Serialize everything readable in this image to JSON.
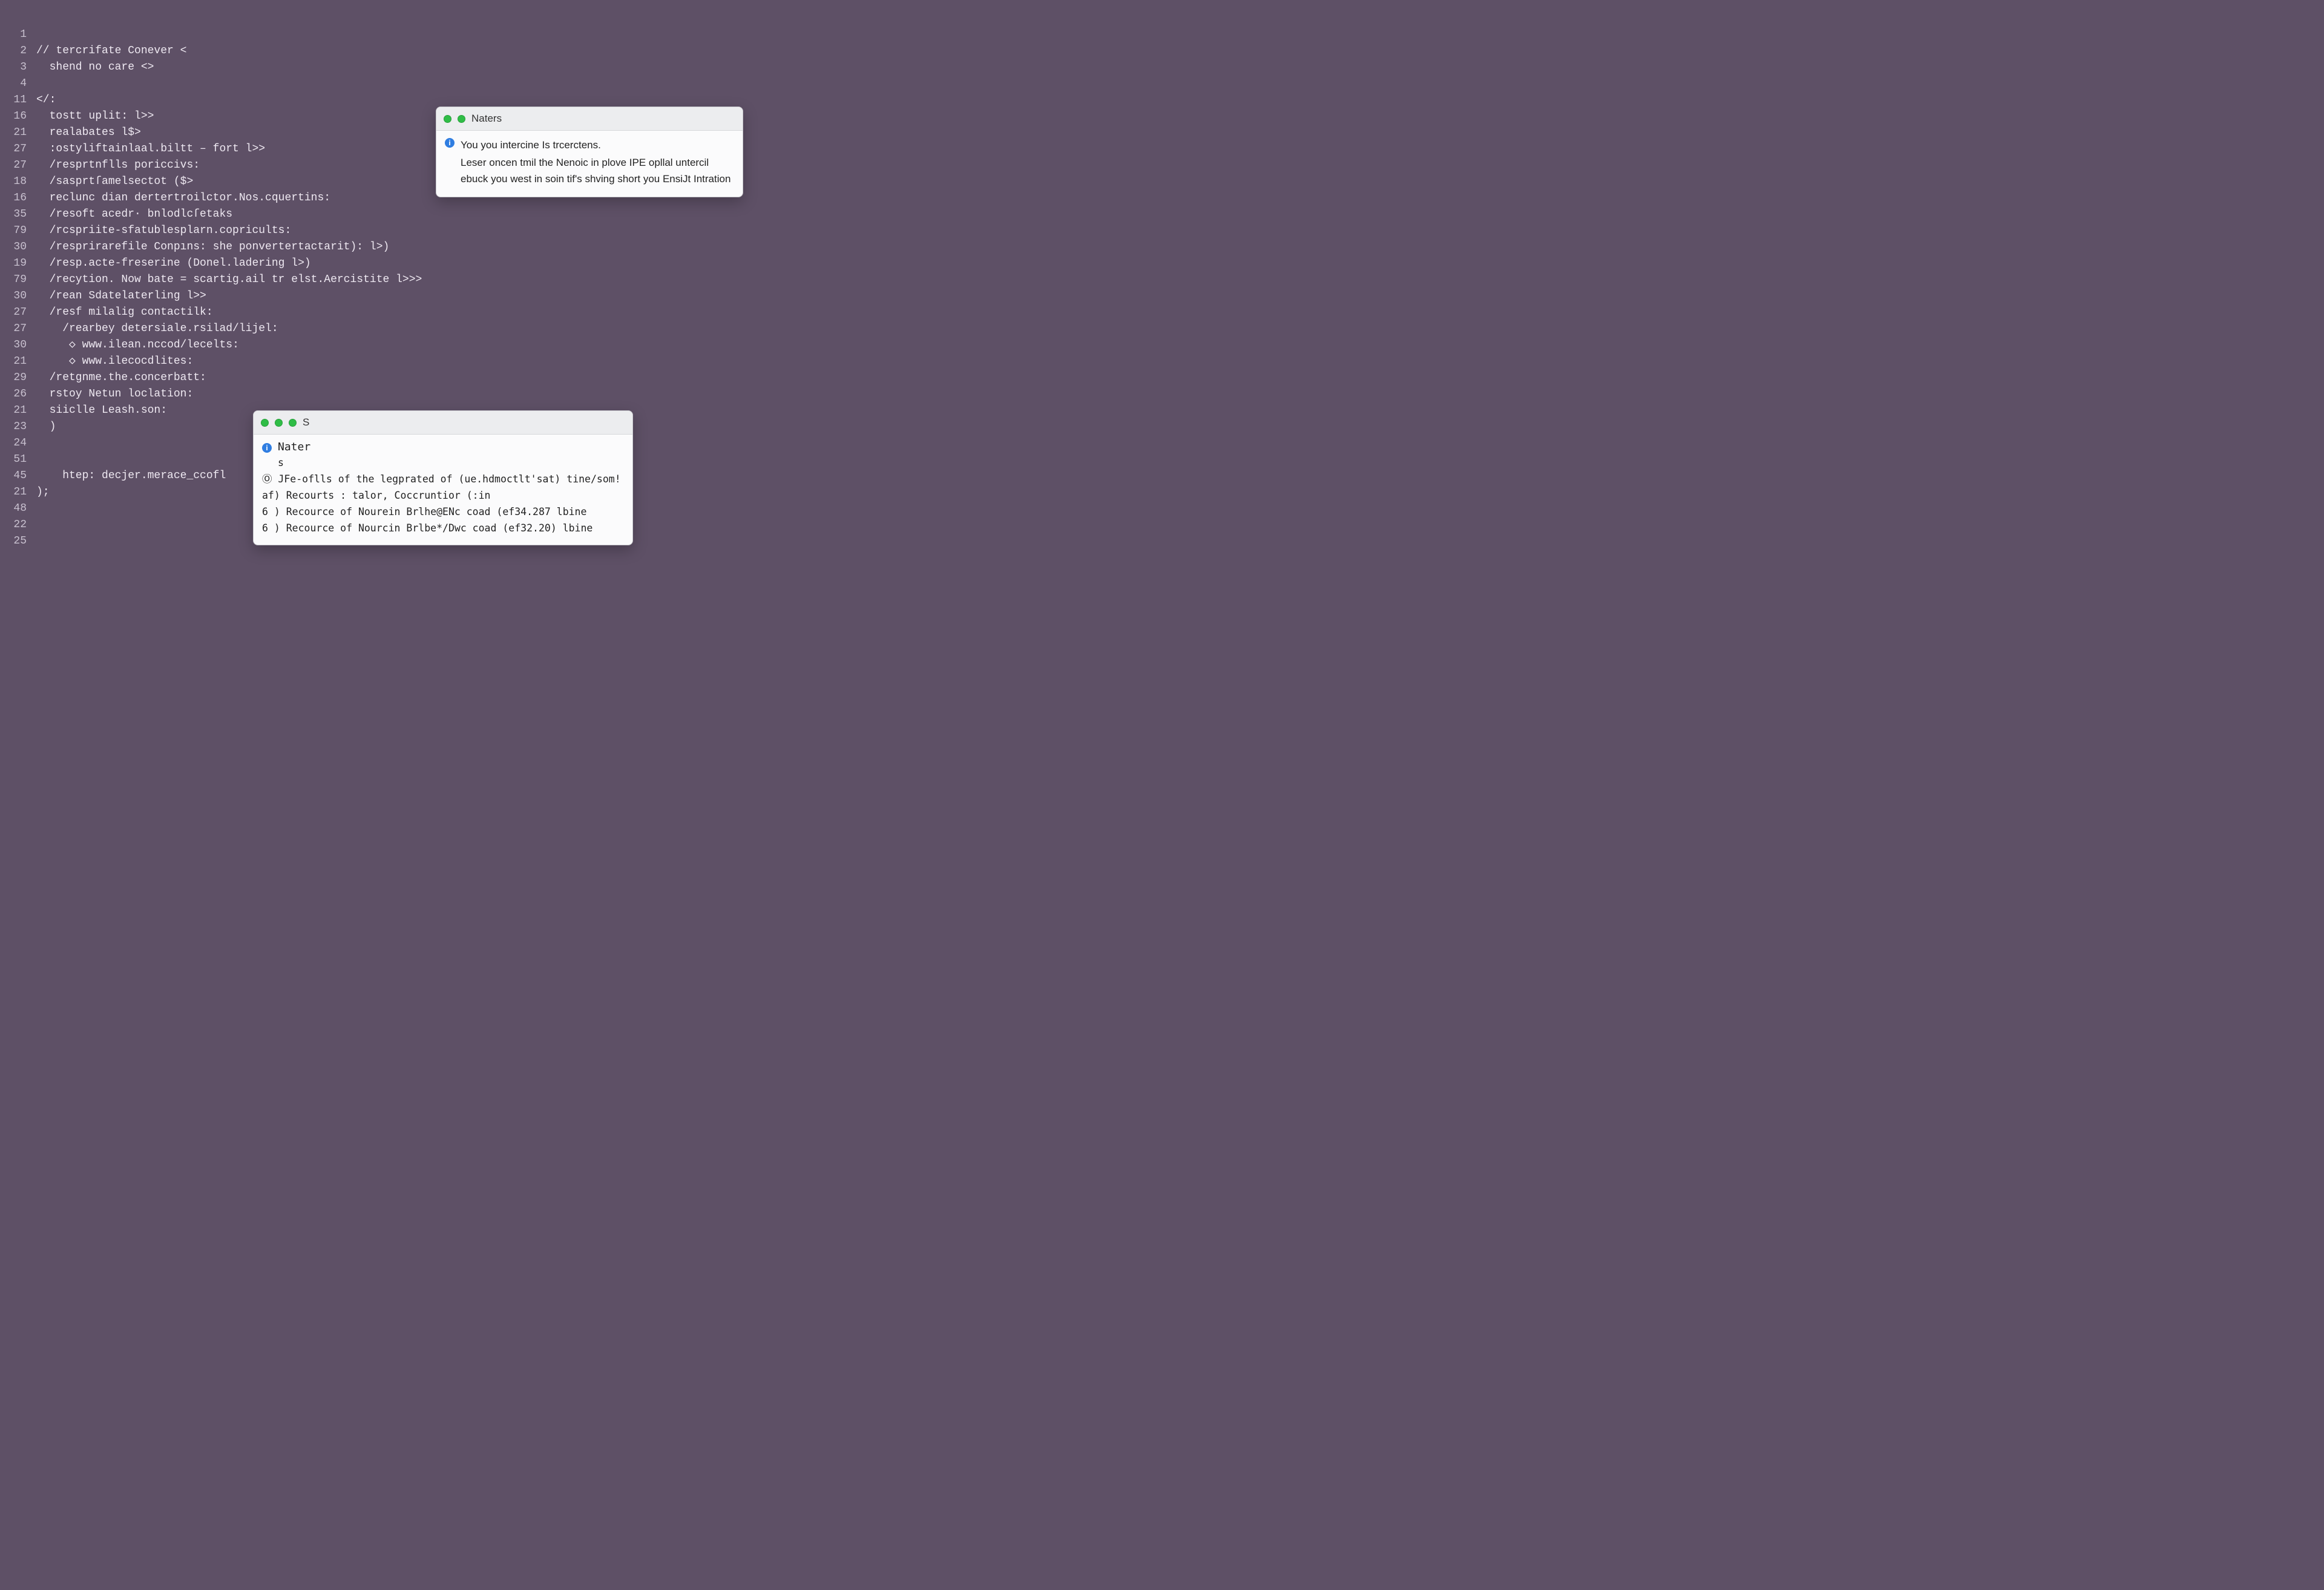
{
  "editor": {
    "lines": [
      {
        "n": "1",
        "t": ""
      },
      {
        "n": "2",
        "t": "// tercrifate Conever <"
      },
      {
        "n": "3",
        "t": "  shend no care <>"
      },
      {
        "n": "4",
        "t": ""
      },
      {
        "n": "11",
        "t": "</:"
      },
      {
        "n": "16",
        "t": "  tostt uplit: l>>"
      },
      {
        "n": "21",
        "t": "  realabates l$>"
      },
      {
        "n": "27",
        "t": "  :ostyliftainlaal.biltt – fort l>>"
      },
      {
        "n": "27",
        "t": "  /resprtnflls poriccivs:"
      },
      {
        "n": "18",
        "t": "  /sasprtſamelsectot ($>"
      },
      {
        "n": "16",
        "t": "  reclunc dian dertertroilctor.Nos.cquertins:"
      },
      {
        "n": "35",
        "t": "  /resoft acedr· bnlodlcſetaks"
      },
      {
        "n": "79",
        "t": "  /rcspriite-sfatublesplarn.copricults:"
      },
      {
        "n": "30",
        "t": "  /resprirarefile Conpıns: she ponvertertactarit): l>)"
      },
      {
        "n": "19",
        "t": "  /resp.acte-freserine (Donel.ladering l>)"
      },
      {
        "n": "79",
        "t": "  /recytion. Now bate = scartig.ail tr elst.Aercistite l>>>"
      },
      {
        "n": "30",
        "t": "  /rean Sdatelaterling l>>"
      },
      {
        "n": "27",
        "t": "  /resf milalig contactilk:"
      },
      {
        "n": "27",
        "t": "    /rearbey detersiale.rsilad/lijel:"
      },
      {
        "n": "30",
        "t": "     ◇ www.ilean.nccod/lecelts:"
      },
      {
        "n": "21",
        "t": "     ◇ www.ilecocdlites:"
      },
      {
        "n": "29",
        "t": "  /retgnme.the.concerbatt:"
      },
      {
        "n": "26",
        "t": "  rstoy Netun loclation:"
      },
      {
        "n": "21",
        "t": "  siiclle Leash.son:"
      },
      {
        "n": "23",
        "t": "  )"
      },
      {
        "n": "24",
        "t": ""
      },
      {
        "n": "51",
        "t": ""
      },
      {
        "n": "45",
        "t": "    htep: decjer.merace_ccofl"
      },
      {
        "n": "21",
        "t": ");"
      },
      {
        "n": "48",
        "t": ""
      },
      {
        "n": "22",
        "t": ""
      },
      {
        "n": "25",
        "t": ""
      }
    ]
  },
  "popup1": {
    "title": "Naters",
    "line1": "You you intercine Is trcerctens.",
    "body": "Leser oncen tmil the Nenoic in plove IPE opllal untercil ebuck you west in soin tif's shving short you EnsiJt Intration"
  },
  "popup2": {
    "title": "S",
    "header": "Nater",
    "sub": "s",
    "lines": [
      "Ⓞ JFe-oflls of the legprated of (ue.hdmoctlt'sat) tine/som!",
      "af) Recourts : talor, Coccruntior (:in",
      "6 ) Recource of Nourein Brlhe@ENc coad (ef34.287 lbine",
      "6 ) Recource of Nourcin Brlbe*/Dwc coad (ef32.20) lbine"
    ]
  }
}
